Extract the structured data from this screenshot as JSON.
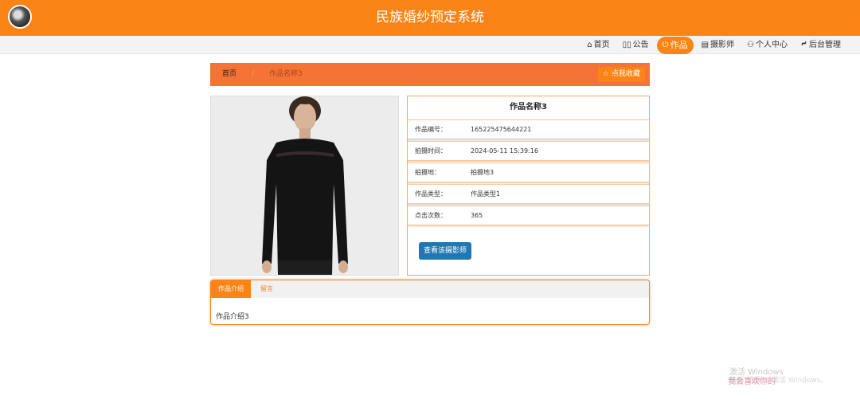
{
  "header": {
    "title": "民族婚纱预定系统"
  },
  "nav": [
    {
      "icon": "home-icon",
      "glyph": "⌂",
      "label": "首页"
    },
    {
      "icon": "notice-icon",
      "glyph": "▯▯",
      "label": "公告"
    },
    {
      "icon": "power-icon",
      "glyph": "⏻",
      "label": "作品",
      "active": true
    },
    {
      "icon": "camera-icon",
      "glyph": "▤",
      "label": "摄影师"
    },
    {
      "icon": "user-icon",
      "glyph": "⚇",
      "label": "个人中心"
    },
    {
      "icon": "link-icon",
      "glyph": "🔗",
      "label": "后台管理"
    }
  ],
  "breadcrumb": {
    "home": "首页",
    "separator": "/",
    "current": "作品名称3",
    "favorite_label": "点我收藏",
    "favorite_icon": "☆"
  },
  "work": {
    "title": "作品名称3",
    "fields": [
      {
        "label": "作品编号：",
        "value": "165225475644221"
      },
      {
        "label": "拍摄时间：",
        "value": "2024-05-11 15:39:16"
      },
      {
        "label": "拍摄地：",
        "value": "拍摄地3"
      },
      {
        "label": "作品类型：",
        "value": "作品类型1"
      },
      {
        "label": "点击次数：",
        "value": "365"
      }
    ],
    "view_photographer_label": "查看该摄影师"
  },
  "tabs": {
    "intro_label": "作品介绍",
    "comment_label": "留言",
    "intro_content": "作品介绍3"
  },
  "watermark": {
    "line1": "激活 Windows",
    "line2": "转到\"设置\"以激活 Windows。",
    "stamp": "我会喜欢你的"
  },
  "colors": {
    "primary": "#fb8416",
    "breadcrumb": "#f57435",
    "button_blue": "#1e78b4"
  }
}
